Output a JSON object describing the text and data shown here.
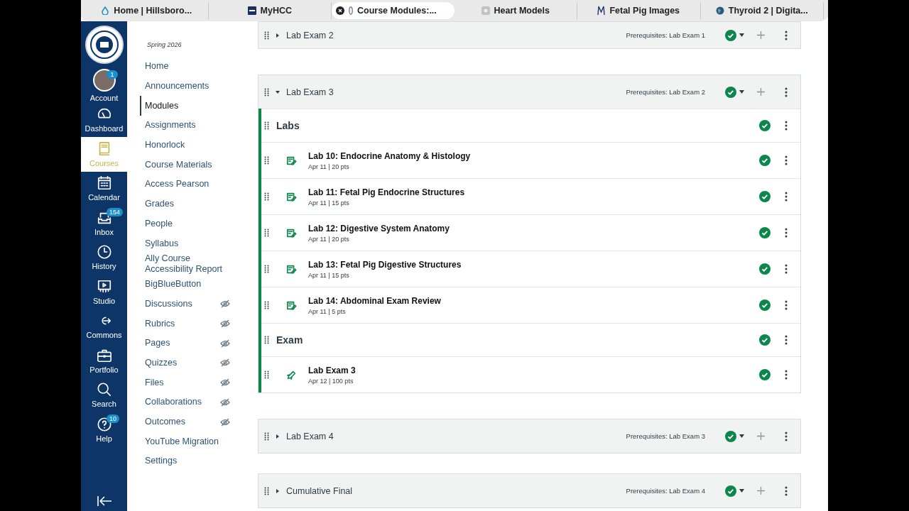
{
  "browser_tabs": [
    {
      "label": "Home | Hillsboro...",
      "kind": "drop",
      "selected": false
    },
    {
      "label": "MyHCC",
      "kind": "logo",
      "selected": false
    },
    {
      "label": "Course Modules:...",
      "kind": "pin",
      "selected": true
    },
    {
      "label": "Heart Models",
      "kind": "square",
      "selected": false
    },
    {
      "label": "Fetal Pig Images",
      "kind": "mark",
      "selected": false
    },
    {
      "label": "Thyroid 2 | Digita...",
      "kind": "globe",
      "selected": false
    }
  ],
  "global_nav": {
    "items": [
      {
        "label": "Account",
        "kind": "avatar",
        "badge": "1",
        "selected": false
      },
      {
        "label": "Dashboard",
        "kind": "dashboard",
        "selected": false
      },
      {
        "label": "Courses",
        "kind": "book",
        "selected": true
      },
      {
        "label": "Calendar",
        "kind": "calendar",
        "selected": false
      },
      {
        "label": "Inbox",
        "kind": "inbox",
        "badge": "154",
        "selected": false
      },
      {
        "label": "History",
        "kind": "clock",
        "selected": false
      },
      {
        "label": "Studio",
        "kind": "studio",
        "selected": false
      },
      {
        "label": "Commons",
        "kind": "commons",
        "selected": false
      },
      {
        "label": "Portfolio",
        "kind": "briefcase",
        "selected": false
      },
      {
        "label": "Search",
        "kind": "search",
        "selected": false
      },
      {
        "label": "Help",
        "kind": "help",
        "badge": "10",
        "selected": false
      }
    ]
  },
  "course_nav": {
    "term": "Spring 2026",
    "items": [
      {
        "label": "Home",
        "selected": false,
        "hidden": false
      },
      {
        "label": "Announcements",
        "selected": false,
        "hidden": false
      },
      {
        "label": "Modules",
        "selected": true,
        "hidden": false
      },
      {
        "label": "Assignments",
        "selected": false,
        "hidden": false
      },
      {
        "label": "Honorlock",
        "selected": false,
        "hidden": false
      },
      {
        "label": "Course Materials",
        "selected": false,
        "hidden": false
      },
      {
        "label": "Access Pearson",
        "selected": false,
        "hidden": false
      },
      {
        "label": "Grades",
        "selected": false,
        "hidden": false
      },
      {
        "label": "People",
        "selected": false,
        "hidden": false
      },
      {
        "label": "Syllabus",
        "selected": false,
        "hidden": false
      },
      {
        "label": "Ally Course Accessibility Report",
        "selected": false,
        "hidden": false
      },
      {
        "label": "BigBlueButton",
        "selected": false,
        "hidden": false
      },
      {
        "label": "Discussions",
        "selected": false,
        "hidden": true
      },
      {
        "label": "Rubrics",
        "selected": false,
        "hidden": true
      },
      {
        "label": "Pages",
        "selected": false,
        "hidden": true
      },
      {
        "label": "Quizzes",
        "selected": false,
        "hidden": true
      },
      {
        "label": "Files",
        "selected": false,
        "hidden": true
      },
      {
        "label": "Collaborations",
        "selected": false,
        "hidden": true
      },
      {
        "label": "Outcomes",
        "selected": false,
        "hidden": true
      },
      {
        "label": "YouTube Migration",
        "selected": false,
        "hidden": false
      },
      {
        "label": "Settings",
        "selected": false,
        "hidden": false
      }
    ]
  },
  "modules": [
    {
      "title": "Lab Exam 2",
      "expanded": false,
      "prerequisites": "Prerequisites: Lab Exam 1",
      "published": true
    },
    {
      "title": "Lab Exam 3",
      "expanded": true,
      "prerequisites": "Prerequisites: Lab Exam 2",
      "published": true,
      "items": [
        {
          "kind": "header",
          "title": "Labs",
          "published": true
        },
        {
          "kind": "assignment",
          "title": "Lab 10: Endocrine Anatomy & Histology",
          "meta": "Apr 11 | 20 pts",
          "published": true
        },
        {
          "kind": "assignment",
          "title": "Lab 11: Fetal Pig Endocrine Structures",
          "meta": "Apr 11 | 15 pts",
          "published": true
        },
        {
          "kind": "assignment",
          "title": "Lab 12: Digestive System Anatomy",
          "meta": "Apr 11 | 20 pts",
          "published": true
        },
        {
          "kind": "assignment",
          "title": "Lab 13: Fetal Pig Digestive Structures",
          "meta": "Apr 11 | 15 pts",
          "published": true
        },
        {
          "kind": "assignment",
          "title": "Lab 14: Abdominal Exam Review",
          "meta": "Apr 11 | 5 pts",
          "published": true
        },
        {
          "kind": "header",
          "title": "Exam",
          "published": true
        },
        {
          "kind": "quiz",
          "title": "Lab Exam 3",
          "meta": "Apr 12 | 100 pts",
          "published": true
        }
      ]
    },
    {
      "title": "Lab Exam 4",
      "expanded": false,
      "prerequisites": "Prerequisites: Lab Exam 3",
      "published": true
    },
    {
      "title": "Cumulative Final",
      "expanded": false,
      "prerequisites": "Prerequisites: Lab Exam 4",
      "published": true
    }
  ]
}
